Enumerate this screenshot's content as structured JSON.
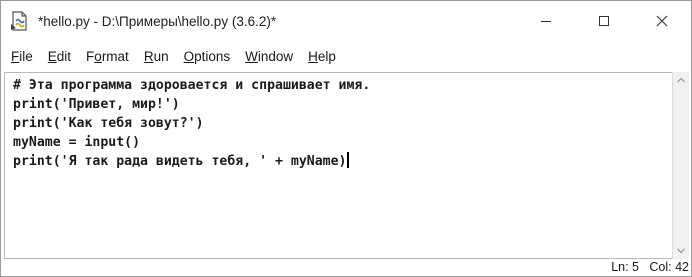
{
  "window": {
    "title": "*hello.py - D:\\Примеры\\hello.py (3.6.2)*",
    "icon": "python-file-icon",
    "controls": {
      "minimize": "minimize-icon",
      "maximize": "maximize-icon",
      "close": "close-icon"
    }
  },
  "menubar": {
    "items": [
      {
        "first": "F",
        "rest": "ile",
        "label": "File"
      },
      {
        "first": "E",
        "rest": "dit",
        "label": "Edit"
      },
      {
        "first": "",
        "label": "Format",
        "pre": "F",
        "ul": "o",
        "post": "rmat"
      },
      {
        "first": "R",
        "rest": "un",
        "label": "Run"
      },
      {
        "first": "O",
        "rest": "ptions",
        "label": "Options"
      },
      {
        "first": "W",
        "rest": "indow",
        "label": "Window"
      },
      {
        "first": "H",
        "rest": "elp",
        "label": "Help"
      }
    ]
  },
  "editor": {
    "lines": [
      "# Эта программа здоровается и спрашивает имя.",
      "print('Привет, мир!')",
      "print('Как тебя зовут?')",
      "myName = input()",
      "print('Я так рада видеть тебя, ' + myName)"
    ]
  },
  "status": {
    "line": "Ln: 5",
    "col": "Col: 42"
  },
  "colors": {
    "background": "#ffffff",
    "text": "#1a1a1a",
    "border": "#b8b8b8"
  }
}
